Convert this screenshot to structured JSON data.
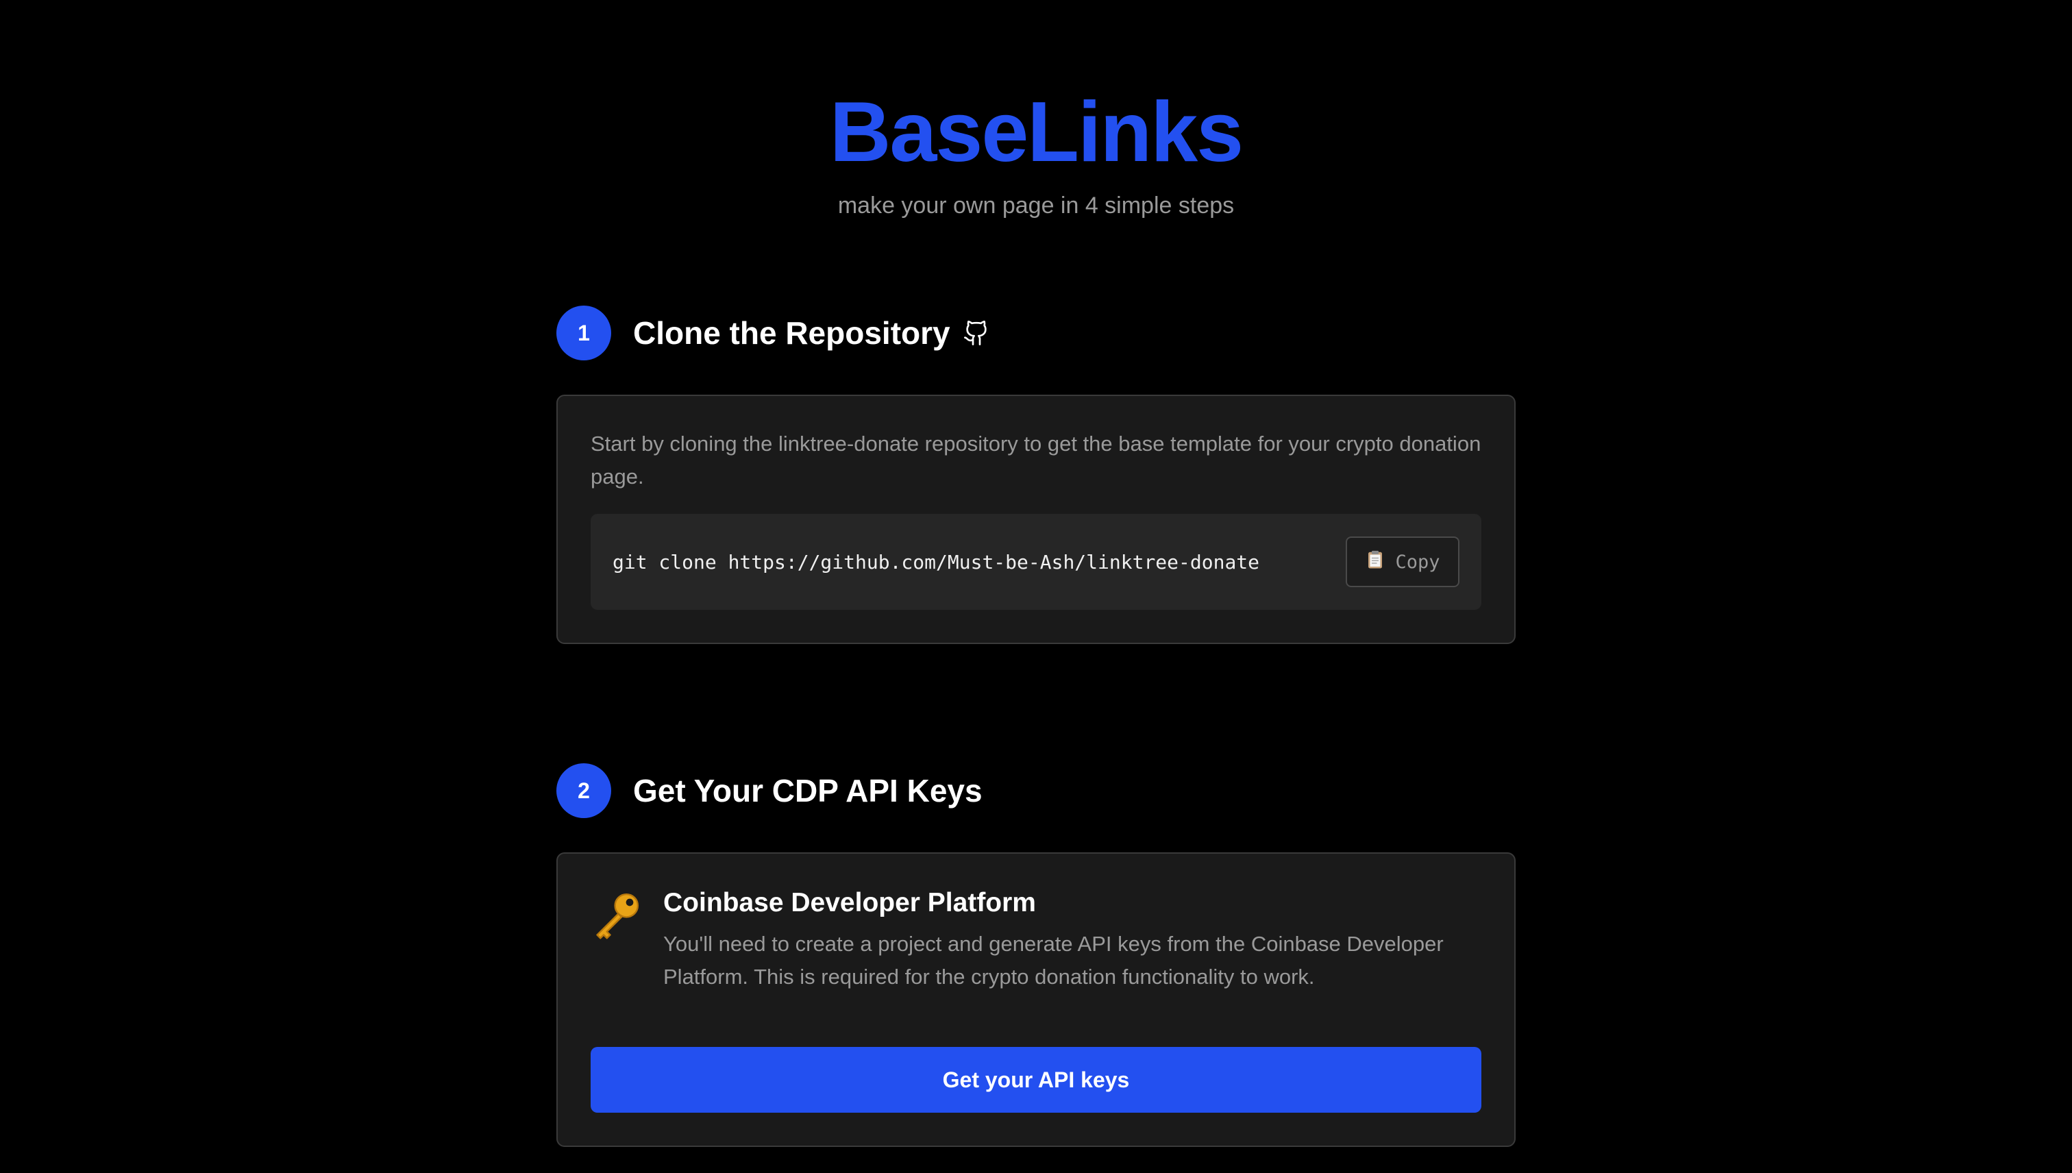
{
  "hero": {
    "title": "BaseLinks",
    "subtitle": "make your own page in 4 simple steps"
  },
  "colors": {
    "accent": "#2350f0",
    "background": "#000000",
    "card": "#1a1a1a",
    "muted_text": "#9a9a9a"
  },
  "steps": [
    {
      "number": "1",
      "title": "Clone the Repository",
      "title_icon": "github-icon",
      "description": "Start by cloning the linktree-donate repository to get the base template for your crypto donation page.",
      "command": "git clone https://github.com/Must-be-Ash/linktree-donate",
      "copy_icon": "clipboard-icon",
      "copy_label": "Copy"
    },
    {
      "number": "2",
      "title": "Get Your CDP API Keys",
      "platform_icon": "key-icon",
      "platform_title": "Coinbase Developer Platform",
      "platform_desc": "You'll need to create a project and generate API keys from the Coinbase Developer Platform. This is required for the crypto donation functionality to work.",
      "button_label": "Get your API keys"
    }
  ]
}
